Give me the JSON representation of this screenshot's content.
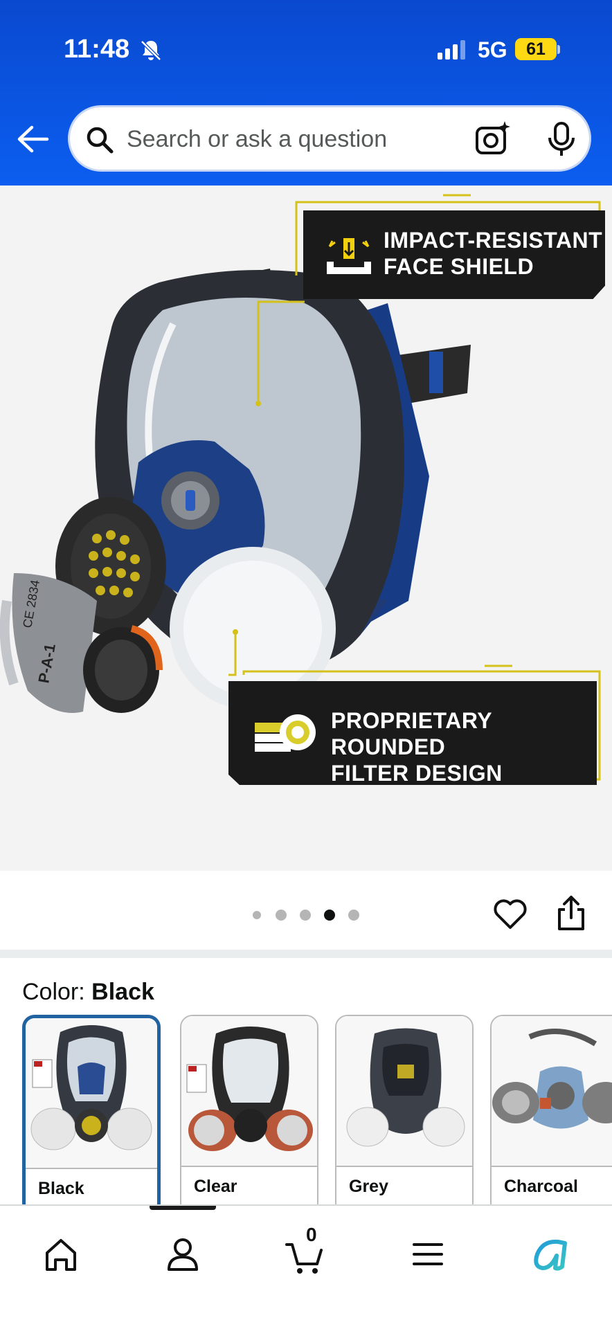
{
  "status_bar": {
    "time": "11:48",
    "network": "5G",
    "battery": "61"
  },
  "search": {
    "placeholder": "Search or ask a question"
  },
  "product_image": {
    "callout_top_line1": "IMPACT-RESISTANT",
    "callout_top_line2": "FACE SHIELD",
    "callout_bottom_line1": "PROPRIETARY ROUNDED",
    "callout_bottom_line2": "FILTER DESIGN",
    "mask_text_1": "P-A-1",
    "mask_text_2": "CE 2834",
    "carousel_total": 5,
    "carousel_active": 4
  },
  "color": {
    "label": "Color:",
    "selected": "Black"
  },
  "swatches": [
    {
      "label": "Black",
      "selected": true
    },
    {
      "label": "Clear",
      "selected": false
    },
    {
      "label": "Grey",
      "selected": false
    },
    {
      "label": "Charcoal",
      "selected": false
    }
  ],
  "bottom_nav": {
    "cart_count": "0"
  },
  "colors": {
    "header": "#0b5ef0",
    "accent": "#2162a1",
    "callout": "#1a1a1a",
    "callout_line": "#d4c11a",
    "battery": "#ffd814"
  }
}
